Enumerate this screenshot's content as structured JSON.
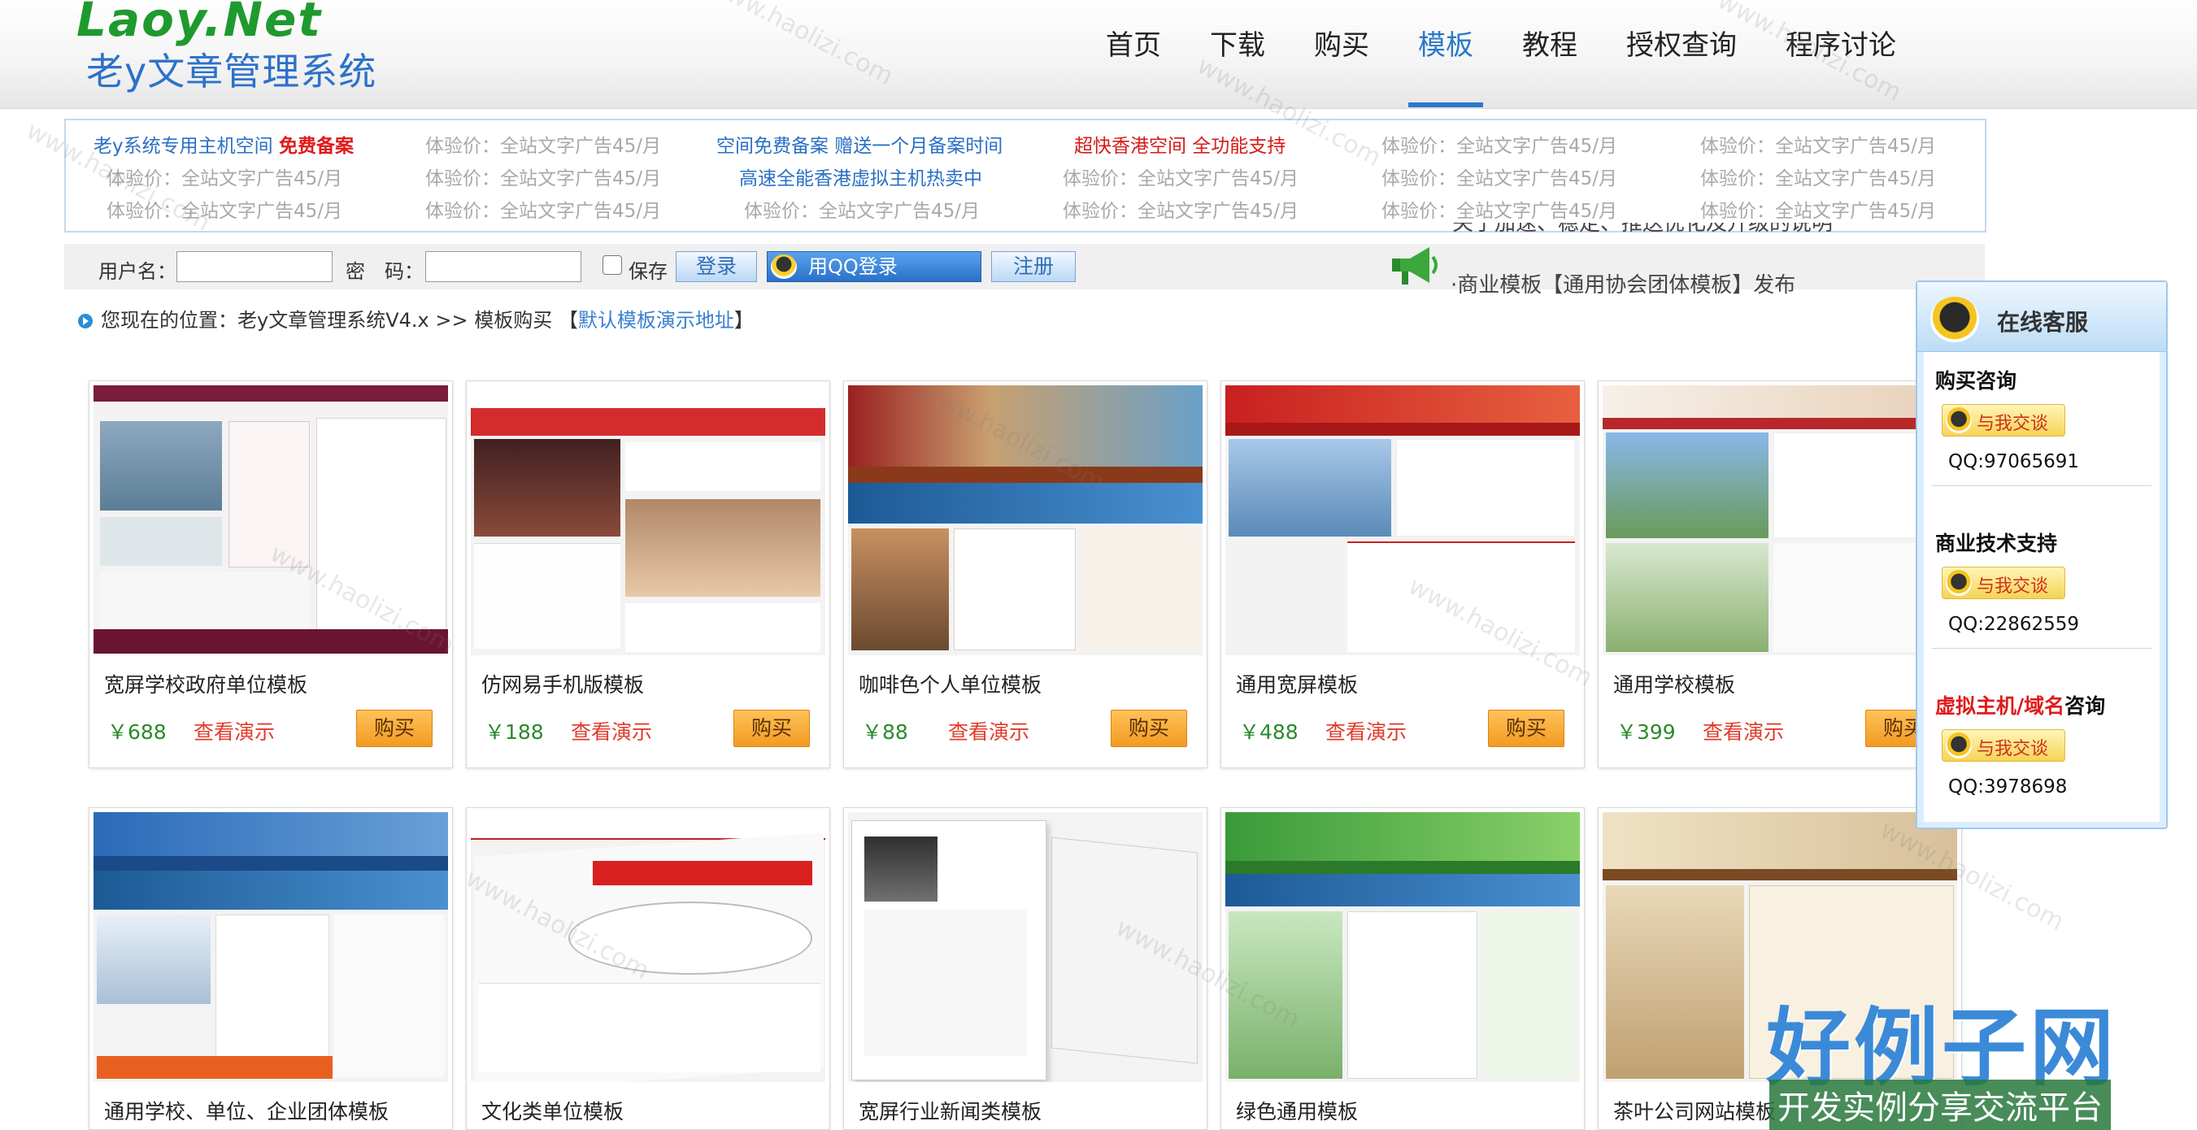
{
  "logo": {
    "en": "Laoy.Net",
    "cn": "老y文章管理系统"
  },
  "nav": [
    {
      "label": "首页"
    },
    {
      "label": "下载"
    },
    {
      "label": "购买"
    },
    {
      "label": "模板",
      "active": true
    },
    {
      "label": "教程"
    },
    {
      "label": "授权查询"
    },
    {
      "label": "程序讨论"
    }
  ],
  "ads": {
    "row1": [
      {
        "pre": "老y系统专用主机空间 ",
        "hl": "免费备案"
      },
      {
        "text": "体验价：全站文字广告45/月"
      },
      {
        "text": "空间免费备案 赠送一个月备案时间"
      },
      {
        "text": "超快香港空间 全功能支持"
      },
      {
        "text": "体验价：全站文字广告45/月"
      },
      {
        "text": "体验价：全站文字广告45/月"
      }
    ],
    "row2": [
      {
        "text": "体验价：全站文字广告45/月"
      },
      {
        "text": "体验价：全站文字广告45/月"
      },
      {
        "text": "高速全能香港虚拟主机热卖中"
      },
      {
        "text": "体验价：全站文字广告45/月"
      },
      {
        "text": "体验价：全站文字广告45/月"
      },
      {
        "text": "体验价：全站文字广告45/月"
      }
    ],
    "row3": [
      {
        "text": "体验价：全站文字广告45/月"
      },
      {
        "text": "体验价：全站文字广告45/月"
      },
      {
        "text": "体验价：全站文字广告45/月"
      },
      {
        "text": "体验价：全站文字广告45/月"
      },
      {
        "text": "体验价：全站文字广告45/月"
      },
      {
        "text": "体验价：全站文字广告45/月"
      }
    ]
  },
  "login": {
    "username_label": "用户名：",
    "password_label": "密　码：",
    "remember_label": "保存",
    "login_button": "登录",
    "qq_login_button": "用QQ登录",
    "register_button": "注册"
  },
  "notice": {
    "line1": "关于加速、稳定、推送优化及升级的说明",
    "line2": "·商业模板【通用协会团体模板】发布"
  },
  "breadcrumb": {
    "prefix": "您现在的位置：老y文章管理系统V4.x >> 模板购买 【",
    "link": "默认模板演示地址",
    "suffix": "】"
  },
  "templates": [
    {
      "title": "宽屏学校政府单位模板",
      "price": "￥688",
      "demo": "查看演示",
      "buy": "购买"
    },
    {
      "title": "仿网易手机版模板",
      "price": "￥188",
      "demo": "查看演示",
      "buy": "购买"
    },
    {
      "title": "咖啡色个人单位模板",
      "price": "￥88",
      "demo": "查看演示",
      "buy": "购买"
    },
    {
      "title": "通用宽屏模板",
      "price": "￥488",
      "demo": "查看演示",
      "buy": "购买"
    },
    {
      "title": "通用学校模板",
      "price": "￥399",
      "demo": "查看演示",
      "buy": "购买"
    },
    {
      "title": "通用学校、单位、企业团体模板"
    },
    {
      "title": "文化类单位模板"
    },
    {
      "title": "宽屏行业新闻类模板"
    },
    {
      "title": "绿色通用模板"
    },
    {
      "title": "茶叶公司网站模板"
    }
  ],
  "service": {
    "title": "在线客服",
    "chat_label": "与我交谈",
    "groups": [
      {
        "name": "购买咨询",
        "qq": "QQ:97065691"
      },
      {
        "name": "商业技术支持",
        "qq": "QQ:22862559"
      },
      {
        "name_red": "虚拟主机/域名",
        "name_rest": "咨询",
        "qq": "QQ:3978698"
      }
    ]
  },
  "watermark": {
    "text": "www.haolizi.com",
    "brand": "好例子网",
    "brand_sub": "开发实例分享交流平台"
  },
  "colors": {
    "accent": "#2a78c8",
    "price": "#2c8a2c",
    "demo": "#e03b2b",
    "buy": "#f29a22",
    "highlight": "#e01b1b"
  }
}
